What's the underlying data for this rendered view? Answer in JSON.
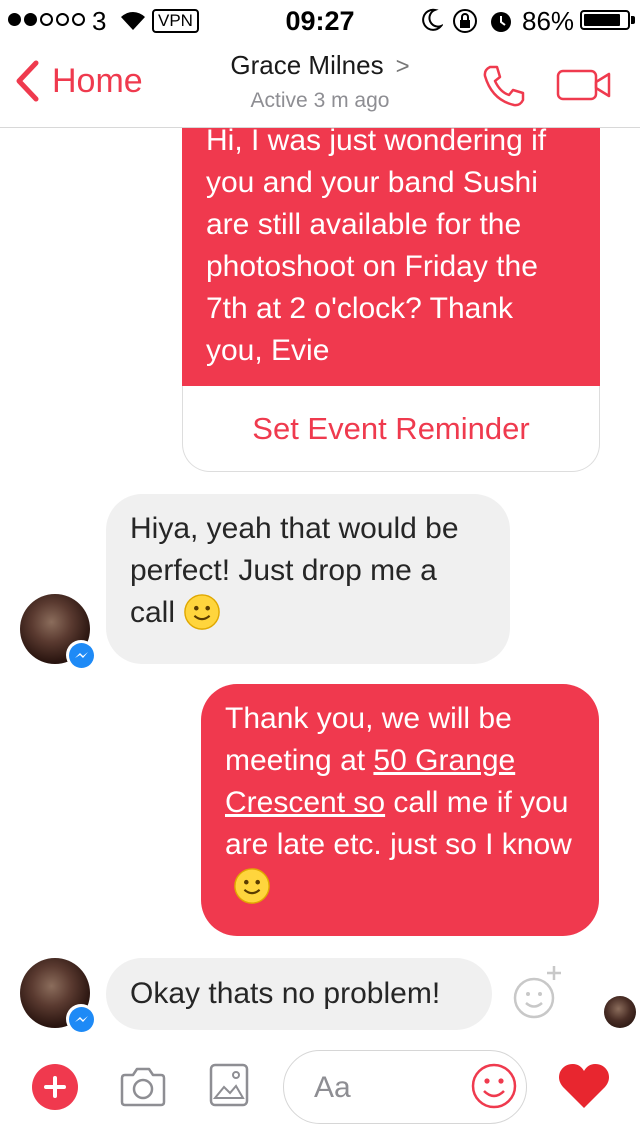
{
  "status_bar": {
    "carrier": "3",
    "vpn": "VPN",
    "time": "09:27",
    "battery_percent": "86%",
    "battery_level": 0.86
  },
  "header": {
    "back_label": "Home",
    "contact_name": "Grace Milnes",
    "contact_chevron": ">",
    "active_status": "Active 3 m ago"
  },
  "messages": [
    {
      "direction": "outgoing",
      "text": "Hi, I was just wondering if you and your band Sushi are still available for the photoshoot on Friday the 7th at 2 o'clock? Thank you, Evie",
      "action_label": "Set Event Reminder"
    },
    {
      "direction": "incoming",
      "text": "Hiya, yeah that would be perfect! Just drop me a call",
      "emoji": "slightly-smiling-face"
    },
    {
      "direction": "outgoing",
      "text_before": "Thank you, we will be meeting at ",
      "link_text": "50 Grange Crescent so",
      "text_after": " call me if you are late etc. just so I know",
      "emoji": "slightly-smiling-face"
    },
    {
      "direction": "incoming",
      "text": "Okay thats no problem!"
    }
  ],
  "composer": {
    "placeholder": "Aa"
  },
  "colors": {
    "accent": "#ef3a4e",
    "outgoing_bubble": "#f0394e",
    "incoming_bubble": "#f0f0f0",
    "messenger_badge": "#1e8af6"
  },
  "icons": [
    "signal-dots-icon",
    "wifi-icon",
    "moon-icon",
    "rotation-lock-icon",
    "alarm-icon",
    "battery-icon",
    "back-chevron-icon",
    "phone-icon",
    "video-camera-icon",
    "messenger-badge-icon",
    "add-reaction-icon",
    "plus-icon",
    "camera-icon",
    "image-icon",
    "emoji-icon",
    "heart-icon"
  ]
}
